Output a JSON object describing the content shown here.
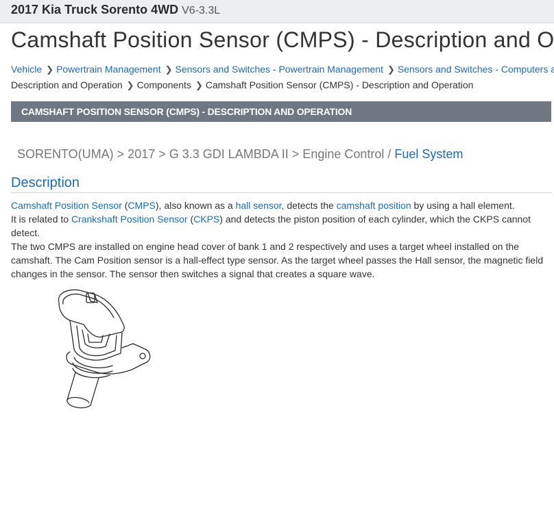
{
  "topbar": {
    "vehicle": "2017 Kia Truck Sorento 4WD",
    "engine": "V6-3.3L"
  },
  "page_title": "Camshaft Position Sensor (CMPS) - Description and Ope",
  "breadcrumb": {
    "row1": [
      "Vehicle",
      "Powertrain Management",
      "Sensors and Switches - Powertrain Management",
      "Sensors and Switches - Computers a"
    ],
    "row2": [
      "Description and Operation",
      "Components",
      "Camshaft Position Sensor (CMPS) - Description and Operation"
    ]
  },
  "section_banner": "CAMSHAFT POSITION SENSOR (CMPS) - DESCRIPTION AND OPERATION",
  "path": {
    "text": "SORENTO(UMA) > 2017 > G 3.3 GDI LAMBDA II > Engine Control / ",
    "last": "Fuel System"
  },
  "description": {
    "heading": "Description",
    "p1": {
      "link1": "Camshaft Position Sensor",
      "t1": " (",
      "link2": "CMPS",
      "t2": "), also known as a ",
      "link3": "hall sensor",
      "t3": ", detects the ",
      "link4": "camshaft position",
      "t4": " by using a hall element."
    },
    "p2": {
      "t1": "It is related to ",
      "link1": "Crankshaft Position Sensor",
      "t2": " (",
      "link2": "CKPS",
      "t3": ") and detects the piston position of each cylinder, which the CKPS cannot detect."
    },
    "p3": "The two CMPS are installed on engine head cover of bank 1 and 2 respectively and uses a target wheel installed on the camshaft. The Cam Position sensor is a hall-effect type sensor. As the target wheel passes the Hall sensor, the magnetic field changes in the sensor. The sensor then switches a signal that creates a square wave."
  }
}
